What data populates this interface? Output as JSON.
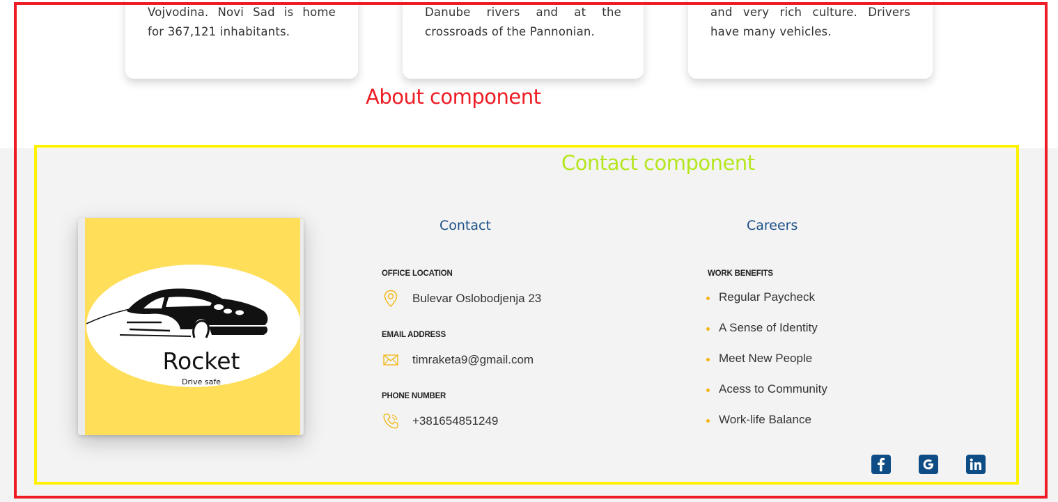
{
  "about": {
    "cards": [
      {
        "line1": "Vojvodina. Novi Sad is home",
        "line2": "for 367,121 inhabitants."
      },
      {
        "line1": "Danube rivers and at the",
        "line2": "crossroads of the Pannonian."
      },
      {
        "line1": "and very rich culture. Drivers",
        "line2": "have many vehicles."
      }
    ]
  },
  "annotations": {
    "about_label": "About component",
    "contact_label": "Contact component",
    "about_color": "#ee1c24",
    "contact_color": "#fff200",
    "contact_label_color": "#b5e61d"
  },
  "logo": {
    "name": "Rocket",
    "tagline": "Drive safe",
    "background": "#ffde59",
    "icon": "car-icon"
  },
  "contact": {
    "title": "Contact",
    "items": [
      {
        "label": "OFFICE LOCATION",
        "value": "Bulevar Oslobodjenja 23",
        "icon": "location-pin-icon"
      },
      {
        "label": "EMAIL ADDRESS",
        "value": "timraketa9@gmail.com",
        "icon": "envelope-icon"
      },
      {
        "label": "PHONE NUMBER",
        "value": "+381654851249",
        "icon": "phone-icon"
      }
    ]
  },
  "careers": {
    "title": "Careers",
    "subtitle": "WORK BENEFITS",
    "benefits": [
      "Regular Paycheck",
      "A Sense of Identity",
      "Meet New People",
      "Acess to Community",
      "Work-life Balance"
    ]
  },
  "social": [
    {
      "name": "facebook",
      "icon": "facebook-icon"
    },
    {
      "name": "google",
      "icon": "google-icon"
    },
    {
      "name": "linkedin",
      "icon": "linkedin-icon"
    }
  ],
  "colors": {
    "accent_yellow": "#f2b50f",
    "heading_blue": "#1b4f86",
    "social_blue": "#0d4c84",
    "band_grey": "#f3f3f3"
  }
}
